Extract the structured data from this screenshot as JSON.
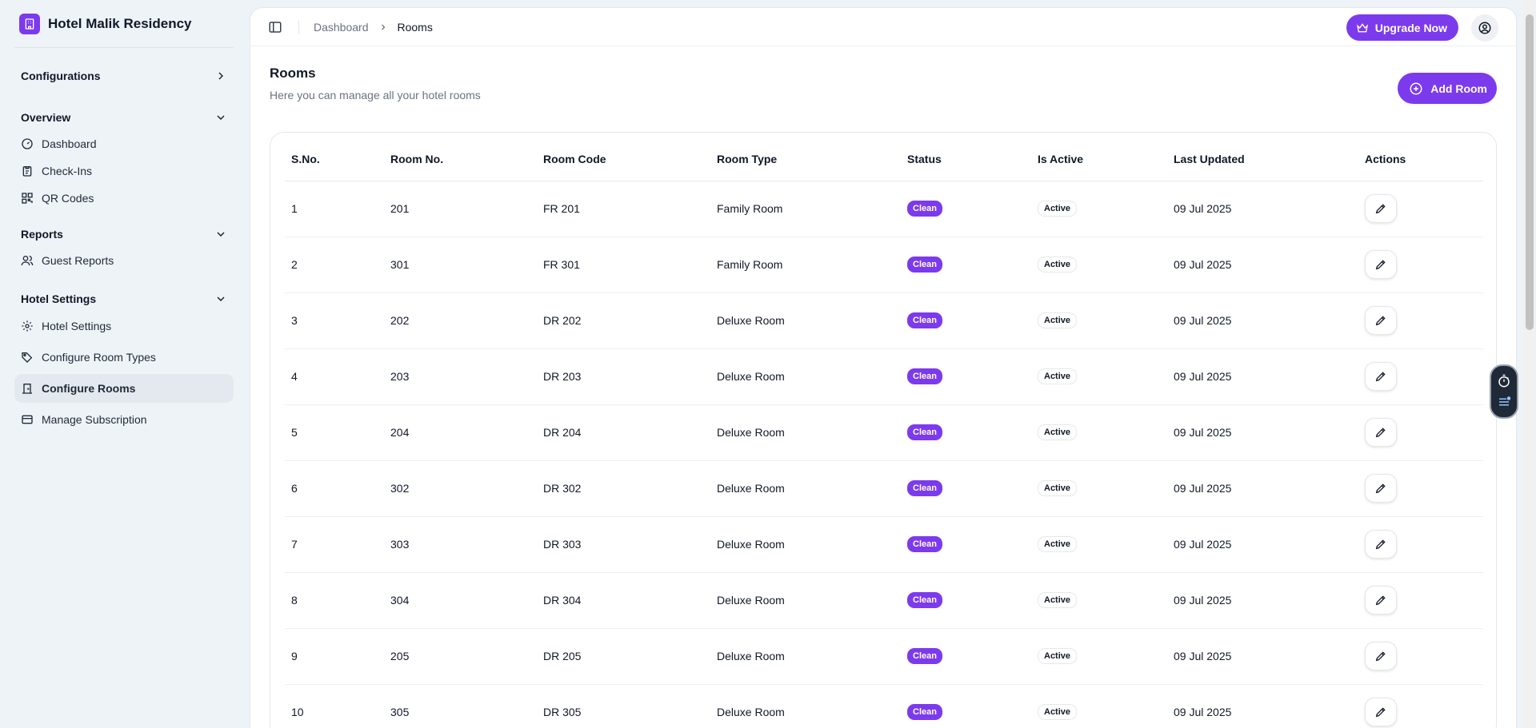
{
  "brand": {
    "name": "Hotel Malik Residency"
  },
  "sidebar": {
    "configurations_label": "Configurations",
    "overview": {
      "label": "Overview",
      "items": [
        {
          "label": "Dashboard",
          "icon": "gauge-icon"
        },
        {
          "label": "Check-Ins",
          "icon": "clipboard-icon"
        },
        {
          "label": "QR Codes",
          "icon": "qr-code-icon"
        }
      ]
    },
    "reports": {
      "label": "Reports",
      "items": [
        {
          "label": "Guest Reports",
          "icon": "users-icon"
        }
      ]
    },
    "hotel_settings": {
      "label": "Hotel Settings",
      "items": [
        {
          "label": "Hotel Settings",
          "icon": "gear-icon"
        },
        {
          "label": "Configure Room Types",
          "icon": "tags-icon"
        },
        {
          "label": "Configure Rooms",
          "icon": "door-icon",
          "active": true
        },
        {
          "label": "Manage Subscription",
          "icon": "credit-card-icon"
        }
      ]
    }
  },
  "breadcrumb": {
    "parent": "Dashboard",
    "current": "Rooms"
  },
  "header": {
    "upgrade_label": "Upgrade Now"
  },
  "page": {
    "title": "Rooms",
    "subtitle": "Here you can manage all your hotel rooms",
    "add_label": "Add Room"
  },
  "table": {
    "columns": [
      "S.No.",
      "Room No.",
      "Room Code",
      "Room Type",
      "Status",
      "Is Active",
      "Last Updated",
      "Actions"
    ],
    "rows": [
      {
        "sno": "1",
        "room_no": "201",
        "code": "FR 201",
        "type": "Family Room",
        "status": "Clean",
        "active": "Active",
        "updated": "09 Jul 2025"
      },
      {
        "sno": "2",
        "room_no": "301",
        "code": "FR 301",
        "type": "Family Room",
        "status": "Clean",
        "active": "Active",
        "updated": "09 Jul 2025"
      },
      {
        "sno": "3",
        "room_no": "202",
        "code": "DR 202",
        "type": "Deluxe Room",
        "status": "Clean",
        "active": "Active",
        "updated": "09 Jul 2025"
      },
      {
        "sno": "4",
        "room_no": "203",
        "code": "DR 203",
        "type": "Deluxe Room",
        "status": "Clean",
        "active": "Active",
        "updated": "09 Jul 2025"
      },
      {
        "sno": "5",
        "room_no": "204",
        "code": "DR 204",
        "type": "Deluxe Room",
        "status": "Clean",
        "active": "Active",
        "updated": "09 Jul 2025"
      },
      {
        "sno": "6",
        "room_no": "302",
        "code": "DR 302",
        "type": "Deluxe Room",
        "status": "Clean",
        "active": "Active",
        "updated": "09 Jul 2025"
      },
      {
        "sno": "7",
        "room_no": "303",
        "code": "DR 303",
        "type": "Deluxe Room",
        "status": "Clean",
        "active": "Active",
        "updated": "09 Jul 2025"
      },
      {
        "sno": "8",
        "room_no": "304",
        "code": "DR 304",
        "type": "Deluxe Room",
        "status": "Clean",
        "active": "Active",
        "updated": "09 Jul 2025"
      },
      {
        "sno": "9",
        "room_no": "205",
        "code": "DR 205",
        "type": "Deluxe Room",
        "status": "Clean",
        "active": "Active",
        "updated": "09 Jul 2025"
      },
      {
        "sno": "10",
        "room_no": "305",
        "code": "DR 305",
        "type": "Deluxe Room",
        "status": "Clean",
        "active": "Active",
        "updated": "09 Jul 2025"
      }
    ]
  },
  "colors": {
    "accent": "#7c3aed",
    "sidebar_bg": "#eef3f8",
    "active_item_bg": "#e4e9ef"
  }
}
